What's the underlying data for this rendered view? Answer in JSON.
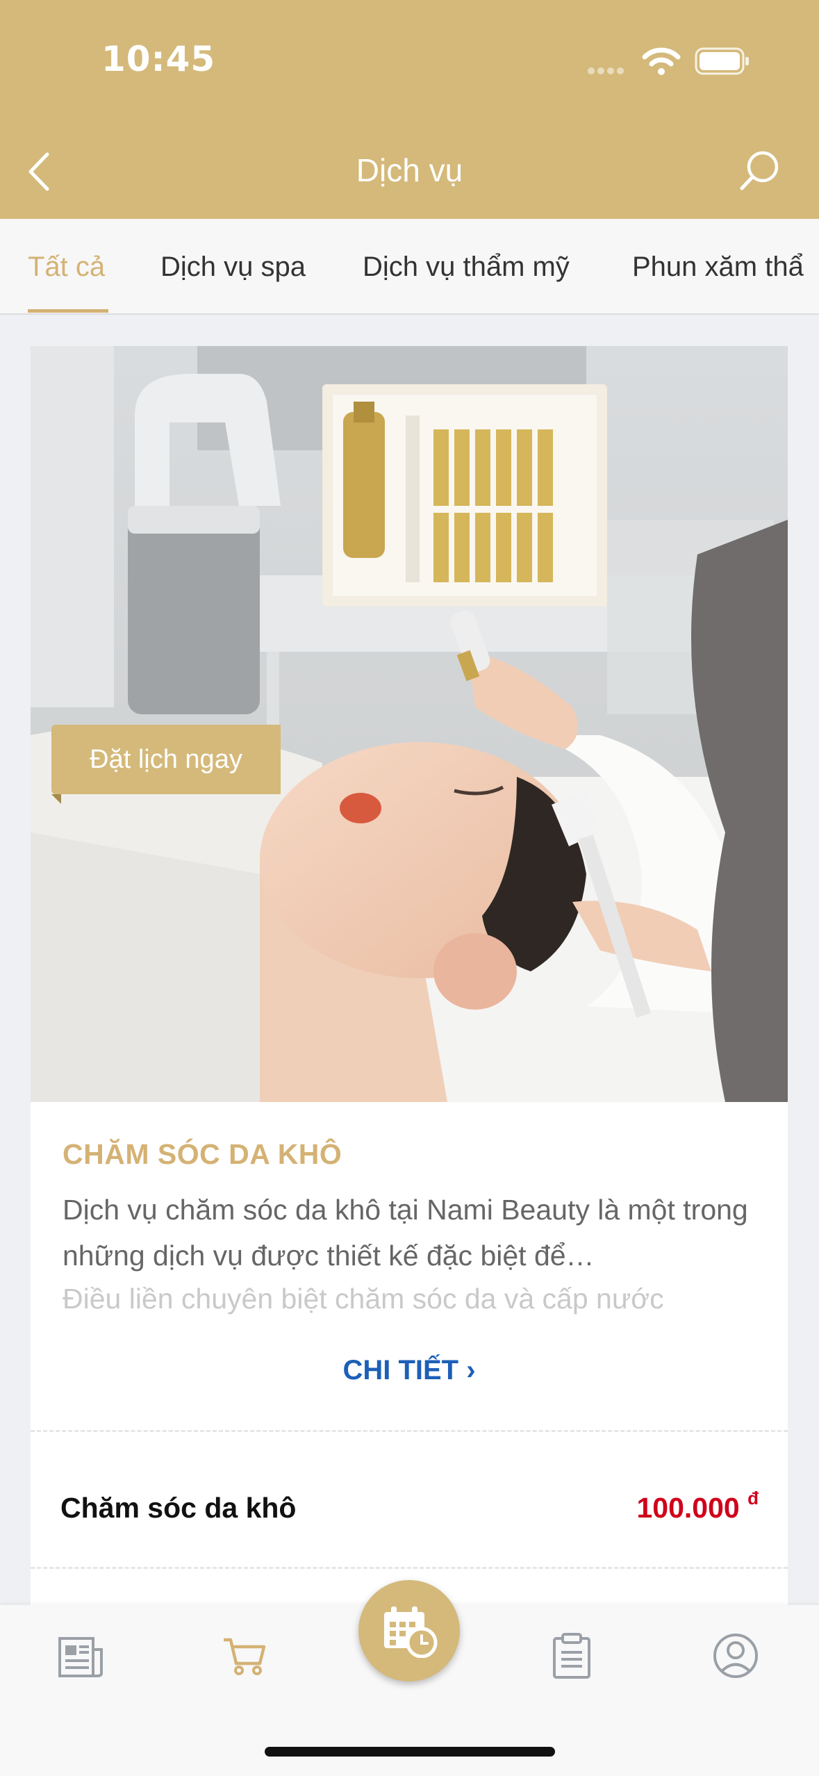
{
  "status_bar": {
    "time": "10:45"
  },
  "header": {
    "title": "Dịch vụ"
  },
  "tabs": [
    {
      "label": "Tất cả",
      "active": true
    },
    {
      "label": "Dịch vụ spa"
    },
    {
      "label": "Dịch vụ thẩm mỹ"
    },
    {
      "label": "Phun xăm thẩ"
    }
  ],
  "card": {
    "book_label": "Đặt lịch ngay",
    "title": "CHĂM SÓC DA KHÔ",
    "description": "Dịch vụ chăm sóc da khô tại Nami Beauty là một trong những dịch vụ được thiết kế đặc biệt để…",
    "description_faded": "Điều liền chuyên biệt chăm sóc da và cấp nước",
    "detail_label": "CHI TIẾT ›",
    "price_name": "Chăm sóc da khô",
    "price_value": "100.000",
    "price_currency": "đ"
  },
  "colors": {
    "brand": "#d4b97a",
    "accent_text": "#d4b274",
    "link": "#1d5fb8",
    "price": "#d0021b"
  },
  "bottom_nav": [
    {
      "icon": "news-icon"
    },
    {
      "icon": "cart-icon",
      "active": true
    },
    {
      "icon": "calendar-clock-icon"
    },
    {
      "icon": "clipboard-icon"
    },
    {
      "icon": "profile-icon"
    }
  ]
}
